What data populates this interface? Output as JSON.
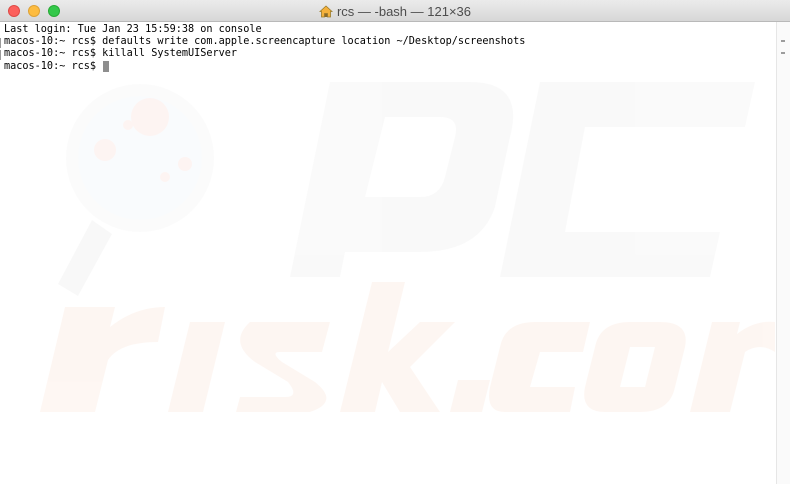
{
  "window": {
    "title": "rcs — -bash — 121×36",
    "title_icon": "home-icon"
  },
  "terminal": {
    "lines": [
      "Last login: Tue Jan 23 15:59:38 on console",
      "macos-10:~ rcs$ defaults write com.apple.screencapture location ~/Desktop/screenshots",
      "macos-10:~ rcs$ killall SystemUIServer"
    ],
    "prompt": "macos-10:~ rcs$ "
  },
  "colors": {
    "close": "#fc605c",
    "minimize": "#fdbc40",
    "zoom": "#34c84a",
    "cursor": "#8e8e8e"
  }
}
